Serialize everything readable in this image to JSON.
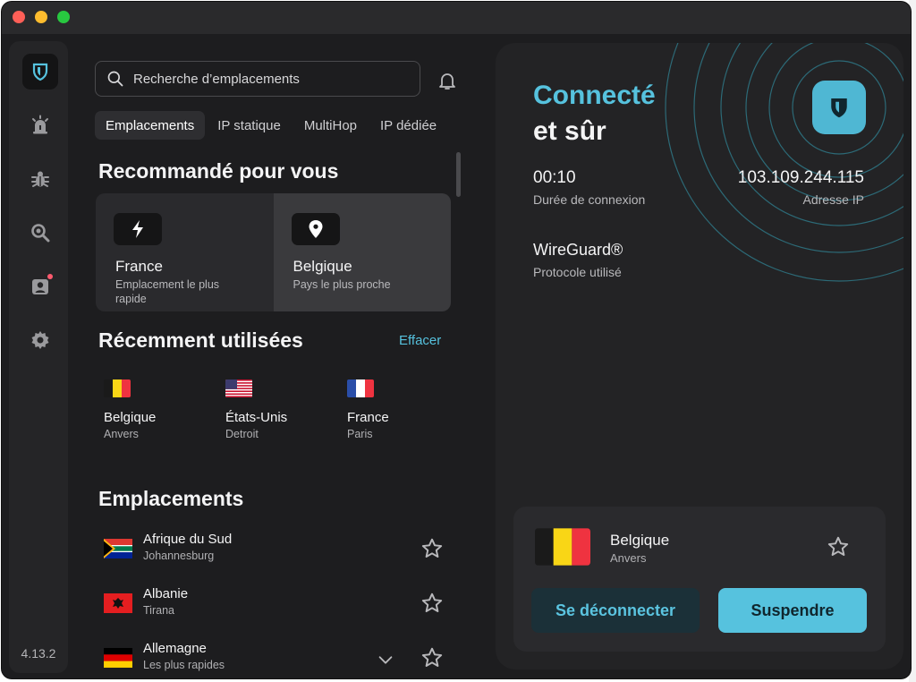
{
  "window": {
    "traffic_lights": [
      "close",
      "minimize",
      "zoom"
    ]
  },
  "rail": {
    "items": [
      {
        "name": "vpn",
        "icon": "shield-icon",
        "active": true
      },
      {
        "name": "alerts",
        "icon": "alarm-icon",
        "active": false
      },
      {
        "name": "antivirus",
        "icon": "bug-icon",
        "active": false
      },
      {
        "name": "scan",
        "icon": "magnifier-icon",
        "active": false
      },
      {
        "name": "identity",
        "icon": "person-badge-icon",
        "active": false,
        "has_dot": true
      },
      {
        "name": "settings",
        "icon": "gear-icon",
        "active": false
      }
    ],
    "version": "4.13.2"
  },
  "search": {
    "placeholder": "Recherche d’emplacements"
  },
  "tabs": [
    {
      "label": "Emplacements",
      "active": true
    },
    {
      "label": "IP statique",
      "active": false
    },
    {
      "label": "MultiHop",
      "active": false
    },
    {
      "label": "IP dédiée",
      "active": false
    }
  ],
  "recommended": {
    "title": "Recommandé pour vous",
    "cards": [
      {
        "name": "France",
        "sub": "Emplacement le plus rapide",
        "icon": "bolt-icon"
      },
      {
        "name": "Belgique",
        "sub": "Pays le plus proche",
        "icon": "location-pin-icon"
      }
    ]
  },
  "recent": {
    "title": "Récemment utilisées",
    "clear_label": "Effacer",
    "items": [
      {
        "name": "Belgique",
        "city": "Anvers",
        "flag": "be"
      },
      {
        "name": "États-Unis",
        "city": "Detroit",
        "flag": "us"
      },
      {
        "name": "France",
        "city": "Paris",
        "flag": "fr"
      }
    ]
  },
  "locations": {
    "title": "Emplacements",
    "items": [
      {
        "name": "Afrique du Sud",
        "city": "Johannesburg",
        "flag": "za"
      },
      {
        "name": "Albanie",
        "city": "Tirana",
        "flag": "al"
      },
      {
        "name": "Allemagne",
        "city": "Les plus rapides",
        "flag": "de",
        "expandable": true
      }
    ]
  },
  "status": {
    "line1": "Connecté",
    "line2": "et sûr",
    "duration": "00:10",
    "duration_label": "Durée de connexion",
    "ip": "103.109.244.115",
    "ip_label": "Adresse IP",
    "protocol": "WireGuard®",
    "protocol_label": "Protocole utilisé"
  },
  "connection": {
    "name": "Belgique",
    "city": "Anvers",
    "flag": "be",
    "disconnect_label": "Se déconnecter",
    "pause_label": "Suspendre"
  },
  "colors": {
    "accent": "#56c2de",
    "background": "#1d1d1f",
    "panel": "#232325"
  }
}
